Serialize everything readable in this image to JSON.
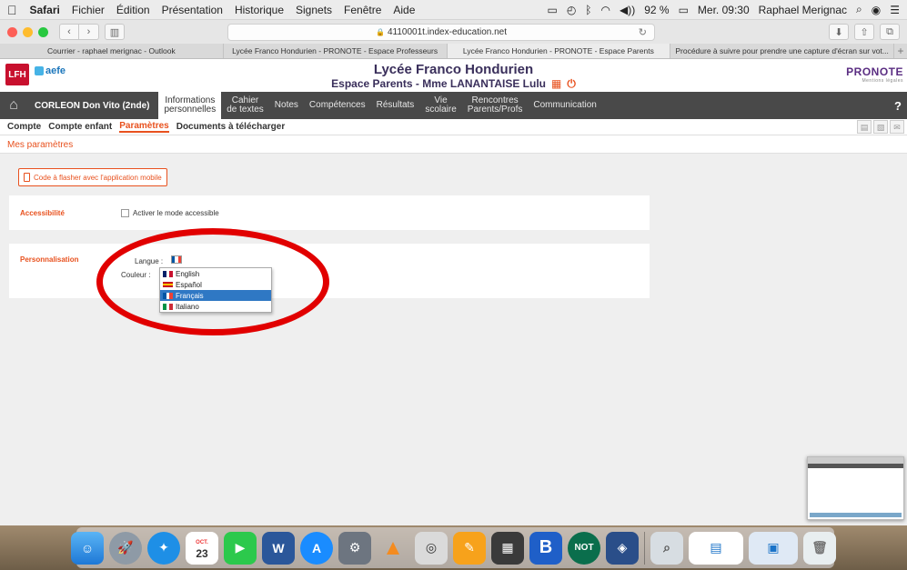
{
  "menubar": {
    "app": "Safari",
    "items": [
      "Fichier",
      "Édition",
      "Présentation",
      "Historique",
      "Signets",
      "Fenêtre",
      "Aide"
    ],
    "battery": "92 %",
    "clock": "Mer. 09:30",
    "user": "Raphael Merignac"
  },
  "browser": {
    "url": "4110001t.index-education.net",
    "tabs": [
      "Courrier - raphael merignac - Outlook",
      "Lycée Franco Hondurien - PRONOTE - Espace Professeurs",
      "Lycée Franco Hondurien - PRONOTE - Espace Parents",
      "Procédure à suivre pour prendre une capture d'écran sur vot..."
    ],
    "active_tab": 2
  },
  "header": {
    "logo_left": "LFH",
    "logo_aefe": "aefe",
    "title": "Lycée Franco Hondurien",
    "subtitle": "Espace Parents - Mme LANANTAISE Lulu",
    "logo_right": "PRONOTE",
    "logo_right_sub": "Mentions légales"
  },
  "nav": {
    "student": "CORLEON Don Vito (2nde)",
    "items": [
      {
        "l1": "Informations",
        "l2": "personnelles",
        "active": true
      },
      {
        "l1": "Cahier",
        "l2": "de textes"
      },
      {
        "l1": "Notes",
        "l2": ""
      },
      {
        "l1": "Compétences",
        "l2": ""
      },
      {
        "l1": "Résultats",
        "l2": ""
      },
      {
        "l1": "Vie",
        "l2": "scolaire"
      },
      {
        "l1": "Rencontres",
        "l2": "Parents/Profs"
      },
      {
        "l1": "Communication",
        "l2": ""
      }
    ],
    "help": "?"
  },
  "subnav": {
    "items": [
      "Compte",
      "Compte enfant",
      "Paramètres",
      "Documents à télécharger"
    ],
    "active": 2
  },
  "page": {
    "title": "Mes paramètres",
    "qr_button": "Code à flasher avec l'application mobile",
    "accessibility": {
      "label": "Accessibilité",
      "checkbox": "Activer le mode accessible"
    },
    "personalisation": {
      "label": "Personnalisation",
      "langue": "Langue :",
      "couleur": "Couleur :"
    }
  },
  "dropdown": {
    "options": [
      {
        "label": "English",
        "flag": [
          "#012169",
          "#ffffff",
          "#c8102e"
        ]
      },
      {
        "label": "Español",
        "flag": [
          "#c60b1e",
          "#ffc400",
          "#c60b1e"
        ]
      },
      {
        "label": "Français",
        "flag": [
          "#0055a4",
          "#ffffff",
          "#ef4135"
        ]
      },
      {
        "label": "Italiano",
        "flag": [
          "#009246",
          "#ffffff",
          "#ce2b37"
        ]
      }
    ],
    "selected": 2
  },
  "dock": {
    "calendar_month": "OCT.",
    "calendar_day": "23",
    "apps": [
      "finder",
      "launchpad",
      "safari",
      "calendar",
      "facetime",
      "word",
      "app-store",
      "system-preferences",
      "vlc",
      "screenshot",
      "pages",
      "calculator",
      "bbedit",
      "notability",
      "virtualbox",
      "preview",
      "outlook",
      "finder-window",
      "trash"
    ]
  },
  "colors": {
    "accent": "#e8511e",
    "nav_bg": "#494949",
    "annotation": "#e10000",
    "selection": "#2f78c4"
  }
}
